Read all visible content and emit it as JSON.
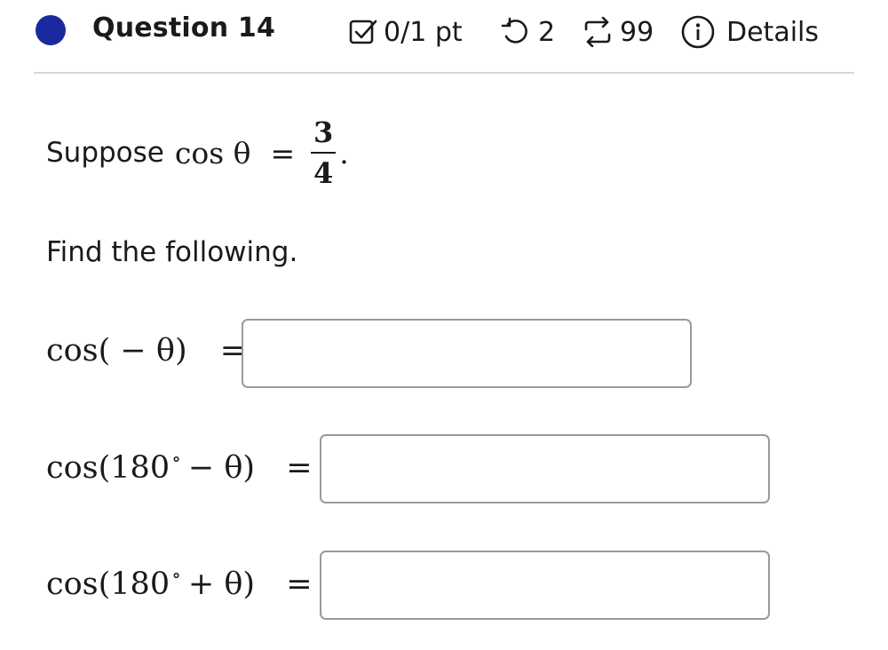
{
  "header": {
    "question_label": "Question 14",
    "score": "0/1 pt",
    "retries": "2",
    "attempts": "99",
    "details_label": "Details",
    "accent_color": "#1a2a9e"
  },
  "prompt": {
    "suppose_label": "Suppose",
    "cos_theta": "cos θ",
    "equals": "=",
    "numerator": "3",
    "denominator": "4",
    "period": ".",
    "find_label": "Find the following."
  },
  "questions": [
    {
      "lhs": "cos( − θ)",
      "equals": "=",
      "value": ""
    },
    {
      "lhs_a": "cos(180",
      "degree": "∘",
      "lhs_b": "− θ)",
      "equals": "=",
      "value": ""
    },
    {
      "lhs_a": "cos(180",
      "degree": "∘",
      "lhs_b": "+ θ)",
      "equals": "=",
      "value": ""
    }
  ]
}
